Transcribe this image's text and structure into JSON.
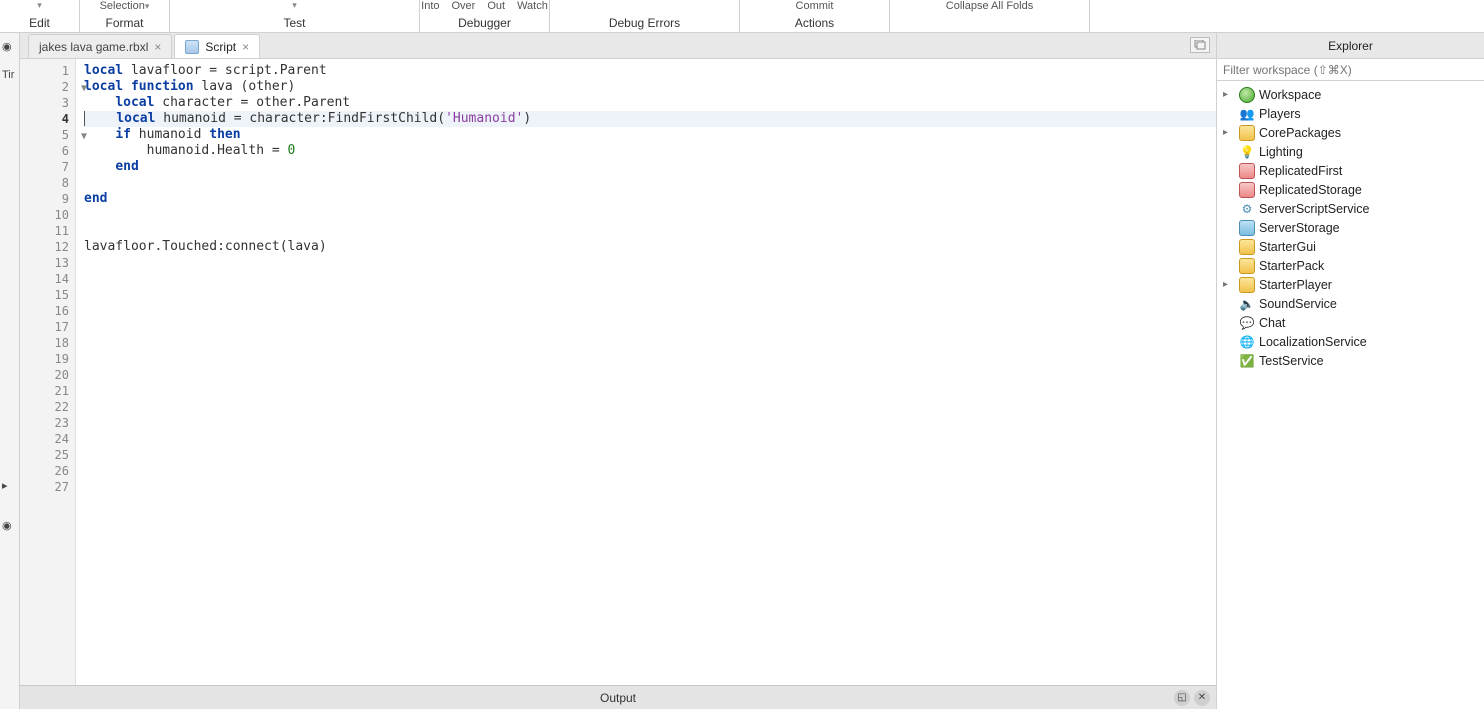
{
  "toolbar": {
    "groups": [
      {
        "top": [
          ""
        ],
        "label": "Edit",
        "dropdown": true
      },
      {
        "top": [
          "Selection"
        ],
        "label": "Format",
        "dropdown": true
      },
      {
        "top": [
          ""
        ],
        "label": "Test",
        "dropdown": true
      },
      {
        "top": [
          "Into",
          "Over",
          "Out",
          "Watch"
        ],
        "label": "Debugger"
      },
      {
        "top": [],
        "label": "Debug Errors"
      },
      {
        "top": [
          "Commit"
        ],
        "label": "Actions"
      },
      {
        "top": [
          "Collapse All Folds"
        ],
        "label": ""
      }
    ]
  },
  "leftgutter": {
    "label": "Tir"
  },
  "tabs": [
    {
      "label": "jakes lava game.rbxl",
      "active": false
    },
    {
      "label": "Script",
      "active": true,
      "icon": "script"
    }
  ],
  "code": {
    "current_line": 4,
    "lines": [
      {
        "n": 1,
        "fold": false,
        "tokens": [
          [
            "kw",
            "local"
          ],
          [
            "id",
            " lavafloor "
          ],
          [
            "op",
            "="
          ],
          [
            "id",
            " script"
          ],
          [
            "op",
            "."
          ],
          [
            "id",
            "Parent"
          ]
        ]
      },
      {
        "n": 2,
        "fold": true,
        "tokens": [
          [
            "kw",
            "local function"
          ],
          [
            "id",
            " lava "
          ],
          [
            "op",
            "("
          ],
          [
            "id",
            "other"
          ],
          [
            "op",
            ")"
          ]
        ]
      },
      {
        "n": 3,
        "fold": false,
        "indent": 1,
        "tokens": [
          [
            "kw",
            "local"
          ],
          [
            "id",
            " character "
          ],
          [
            "op",
            "="
          ],
          [
            "id",
            " other"
          ],
          [
            "op",
            "."
          ],
          [
            "id",
            "Parent"
          ]
        ]
      },
      {
        "n": 4,
        "fold": false,
        "indent": 1,
        "hl": true,
        "tokens": [
          [
            "kw",
            "local"
          ],
          [
            "id",
            " humanoid "
          ],
          [
            "op",
            "="
          ],
          [
            "id",
            " character"
          ],
          [
            "op",
            ":"
          ],
          [
            "fn",
            "FindFirstChild"
          ],
          [
            "op",
            "("
          ],
          [
            "str",
            "'Humanoid'"
          ],
          [
            "op",
            ")"
          ]
        ]
      },
      {
        "n": 5,
        "fold": true,
        "indent": 1,
        "tokens": [
          [
            "kw",
            "if"
          ],
          [
            "id",
            " humanoid "
          ],
          [
            "kw",
            "then"
          ]
        ]
      },
      {
        "n": 6,
        "fold": false,
        "indent": 2,
        "tokens": [
          [
            "id",
            "humanoid"
          ],
          [
            "op",
            "."
          ],
          [
            "id",
            "Health "
          ],
          [
            "op",
            "="
          ],
          [
            "id",
            " "
          ],
          [
            "num",
            "0"
          ]
        ]
      },
      {
        "n": 7,
        "fold": false,
        "indent": 1,
        "tokens": [
          [
            "kw",
            "end"
          ]
        ]
      },
      {
        "n": 8,
        "fold": false,
        "tokens": []
      },
      {
        "n": 9,
        "fold": false,
        "tokens": [
          [
            "kw",
            "end"
          ]
        ]
      },
      {
        "n": 10,
        "fold": false,
        "tokens": []
      },
      {
        "n": 11,
        "fold": false,
        "tokens": []
      },
      {
        "n": 12,
        "fold": false,
        "tokens": [
          [
            "id",
            "lavafloor"
          ],
          [
            "op",
            "."
          ],
          [
            "id",
            "Touched"
          ],
          [
            "op",
            ":"
          ],
          [
            "fn",
            "connect"
          ],
          [
            "op",
            "("
          ],
          [
            "id",
            "lava"
          ],
          [
            "op",
            ")"
          ]
        ]
      },
      {
        "n": 13,
        "fold": false,
        "tokens": []
      },
      {
        "n": 14,
        "fold": false,
        "tokens": []
      },
      {
        "n": 15,
        "fold": false,
        "tokens": []
      },
      {
        "n": 16,
        "fold": false,
        "tokens": []
      },
      {
        "n": 17,
        "fold": false,
        "tokens": []
      },
      {
        "n": 18,
        "fold": false,
        "tokens": []
      },
      {
        "n": 19,
        "fold": false,
        "tokens": []
      },
      {
        "n": 20,
        "fold": false,
        "tokens": []
      },
      {
        "n": 21,
        "fold": false,
        "tokens": []
      },
      {
        "n": 22,
        "fold": false,
        "tokens": []
      },
      {
        "n": 23,
        "fold": false,
        "tokens": []
      },
      {
        "n": 24,
        "fold": false,
        "tokens": []
      },
      {
        "n": 25,
        "fold": false,
        "tokens": []
      },
      {
        "n": 26,
        "fold": false,
        "tokens": []
      },
      {
        "n": 27,
        "fold": false,
        "tokens": []
      }
    ]
  },
  "output": {
    "title": "Output"
  },
  "explorer": {
    "title": "Explorer",
    "filter_placeholder": "Filter workspace (⇧⌘X)",
    "items": [
      {
        "label": "Workspace",
        "icon": "ws",
        "expand": true
      },
      {
        "label": "Players",
        "icon": "players"
      },
      {
        "label": "CorePackages",
        "icon": "folder",
        "expand": true
      },
      {
        "label": "Lighting",
        "icon": "light"
      },
      {
        "label": "ReplicatedFirst",
        "icon": "repl"
      },
      {
        "label": "ReplicatedStorage",
        "icon": "repl"
      },
      {
        "label": "ServerScriptService",
        "icon": "gear"
      },
      {
        "label": "ServerStorage",
        "icon": "storage"
      },
      {
        "label": "StarterGui",
        "icon": "folder"
      },
      {
        "label": "StarterPack",
        "icon": "folder"
      },
      {
        "label": "StarterPlayer",
        "icon": "folder",
        "expand": true
      },
      {
        "label": "SoundService",
        "icon": "sound"
      },
      {
        "label": "Chat",
        "icon": "chat"
      },
      {
        "label": "LocalizationService",
        "icon": "globe"
      },
      {
        "label": "TestService",
        "icon": "test"
      }
    ]
  }
}
